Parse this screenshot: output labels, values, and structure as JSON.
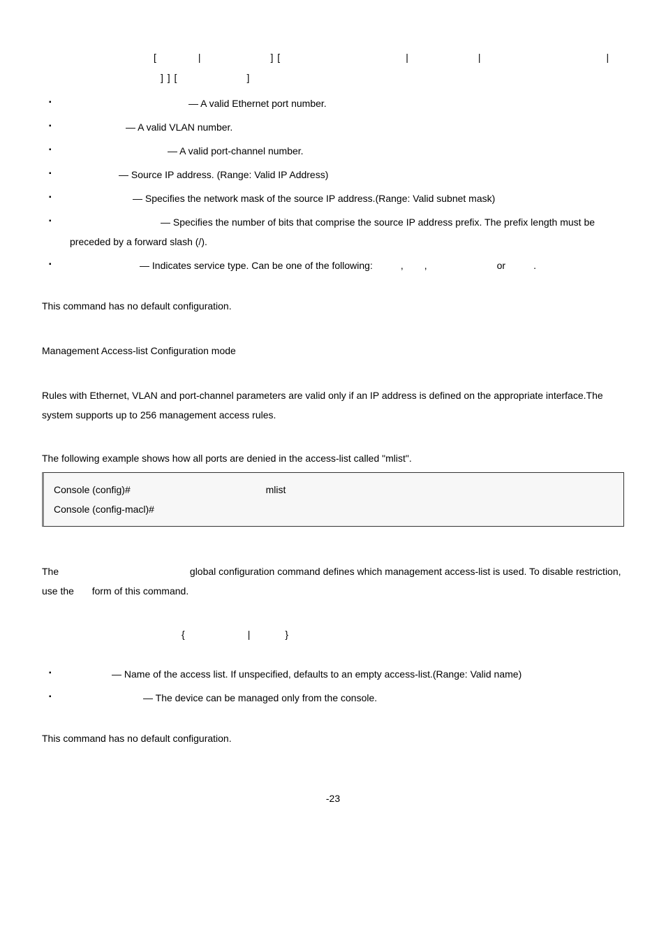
{
  "syntax": {
    "line1_parts": [
      "[",
      "|",
      "] [",
      "|",
      "|",
      "|"
    ],
    "line2_parts": [
      "] ] [",
      "]"
    ]
  },
  "params_block1": [
    "— A valid Ethernet port number.",
    "— A valid VLAN number.",
    "— A valid port-channel number.",
    "— Source IP address. (Range: Valid IP Address)",
    "— Specifies the network mask of the source IP address.(Range: Valid subnet mask)",
    "— Specifies the number of bits that comprise the source IP address prefix. The prefix length must be preceded by a forward slash (/).",
    "— Indicates service type. Can be one of the following:       ,      ,                     or         ."
  ],
  "default1": "This command has no default configuration.",
  "mode1": "Management Access-list Configuration mode",
  "guidelines1": "Rules with Ethernet, VLAN and port-channel parameters are valid only if an IP address is defined on the appropriate interface.The system supports up to 256 management access rules.",
  "example_intro": "The following example shows how all ports are denied in the access-list called \"mlist\".",
  "code": {
    "line1_left": "Console (config)# ",
    "line1_right": "mlist",
    "line2": "Console (config-macl)# "
  },
  "desc2_part1": "The ",
  "desc2_part2": " global configuration command defines which management access-list is used. To disable restriction, use the ",
  "desc2_part3": " form of this command.",
  "syntax2": "{                |          }",
  "params_block2": [
    "— Name of the access list. If unspecified, defaults to an empty access-list.(Range: Valid name)",
    "— The device can be managed only from the console."
  ],
  "default2": "This command has no default configuration.",
  "page_number": "-23"
}
